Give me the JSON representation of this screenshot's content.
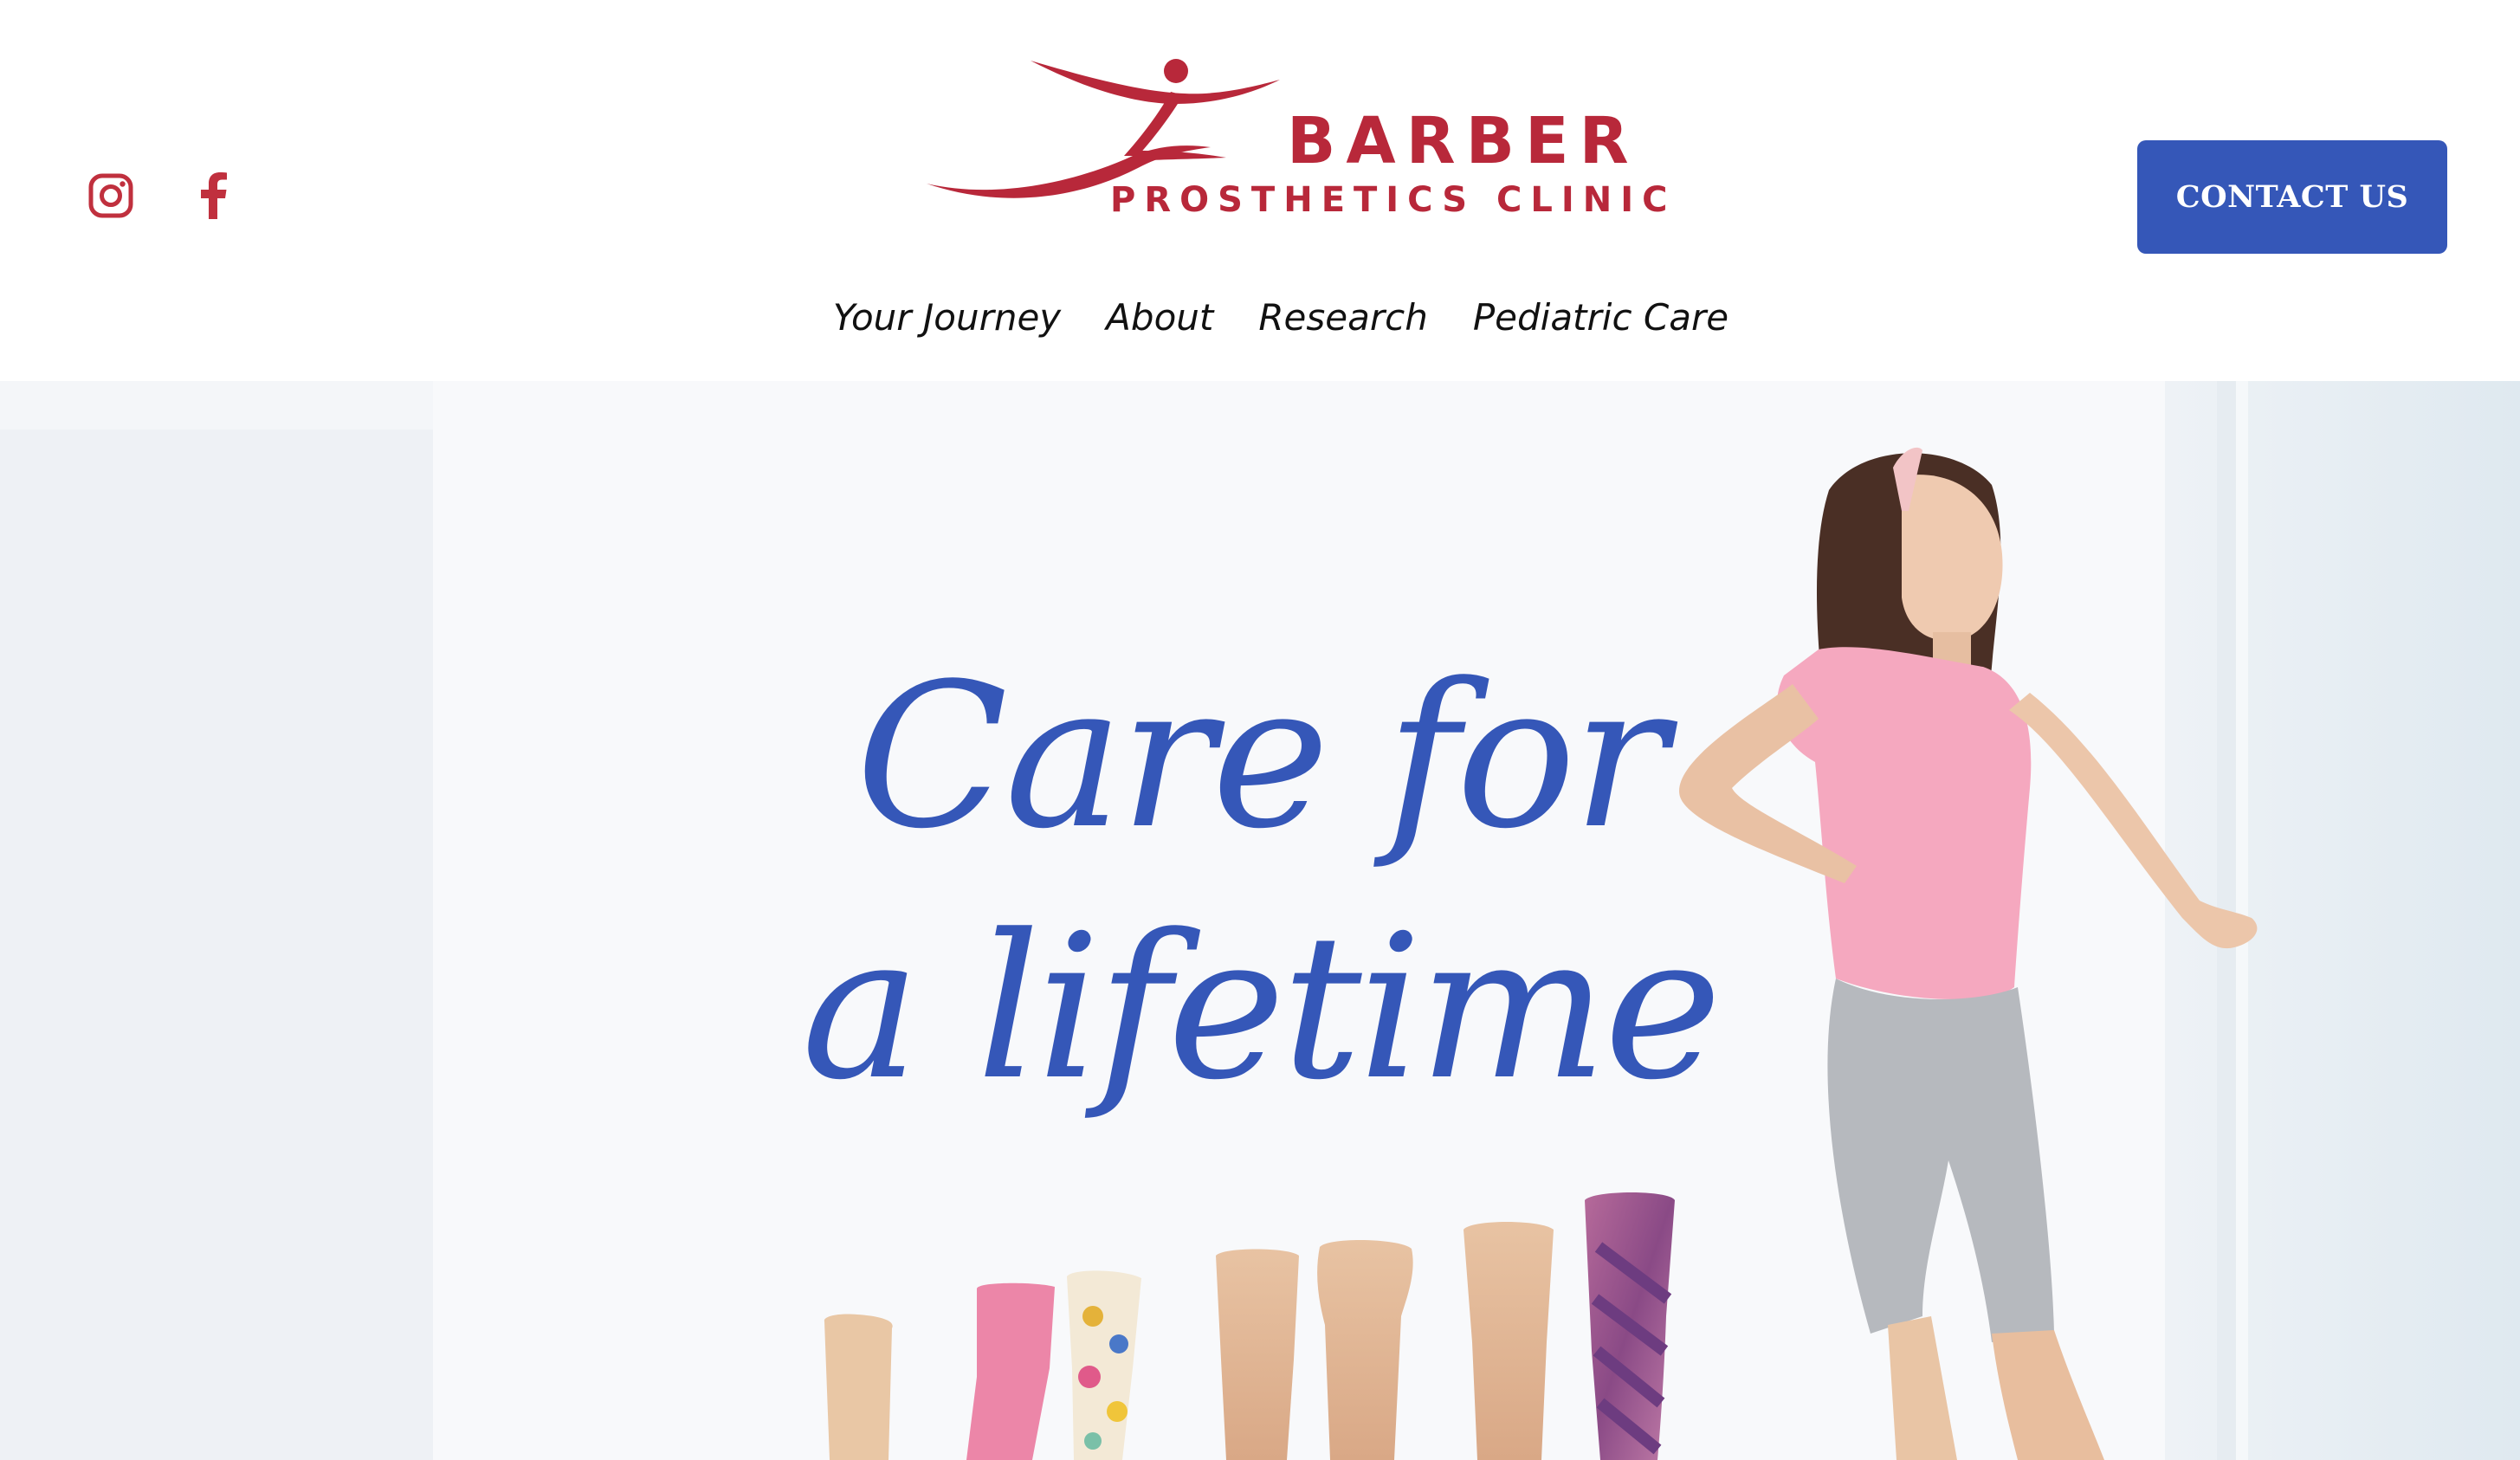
{
  "header": {
    "social": [
      {
        "icon": "instagram-icon"
      },
      {
        "icon": "facebook-icon"
      }
    ],
    "logo": {
      "line1": "BARBER",
      "line2": "PROSTHETICS CLINIC"
    },
    "contact_label": "CONTACT US"
  },
  "nav": {
    "items": [
      "Your Journey",
      "About",
      "Research",
      "Pediatric Care"
    ]
  },
  "hero": {
    "headline_line1": "Care for",
    "headline_line2": "a lifetime"
  },
  "colors": {
    "brand_red": "#b8283a",
    "accent_blue": "#3557b8",
    "nav_text": "#111111",
    "background": "#ffffff"
  }
}
